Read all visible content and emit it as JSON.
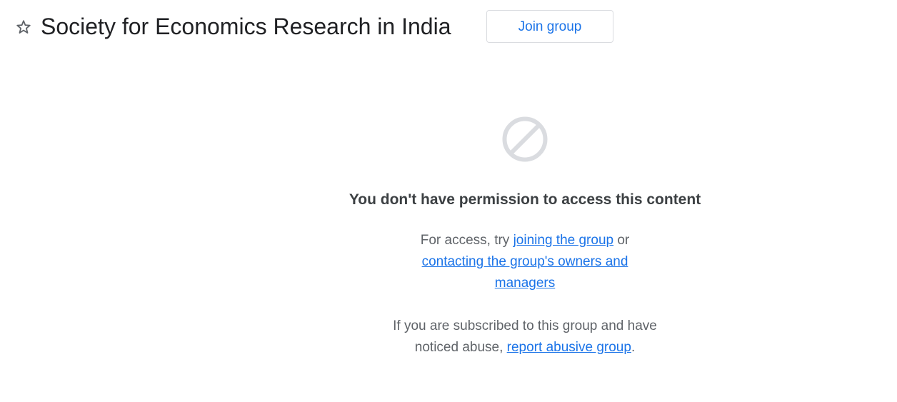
{
  "header": {
    "star_icon": "star-outline-icon",
    "title": "Society for Economics Research in India",
    "join_button_label": "Join group"
  },
  "content": {
    "blocked_icon": "blocked-icon",
    "heading": "You don't have permission to access this content",
    "access_prefix": "For access, try ",
    "join_link": "joining the group",
    "access_middle": " or ",
    "contact_link": "contacting the group's owners and managers",
    "abuse_prefix": "If you are subscribed to this group and have noticed abuse, ",
    "report_link": "report abusive group",
    "abuse_suffix": "."
  },
  "colors": {
    "link": "#1a73e8",
    "title": "#202124",
    "body_text": "#5f6368",
    "icon_gray": "#dadce0"
  }
}
